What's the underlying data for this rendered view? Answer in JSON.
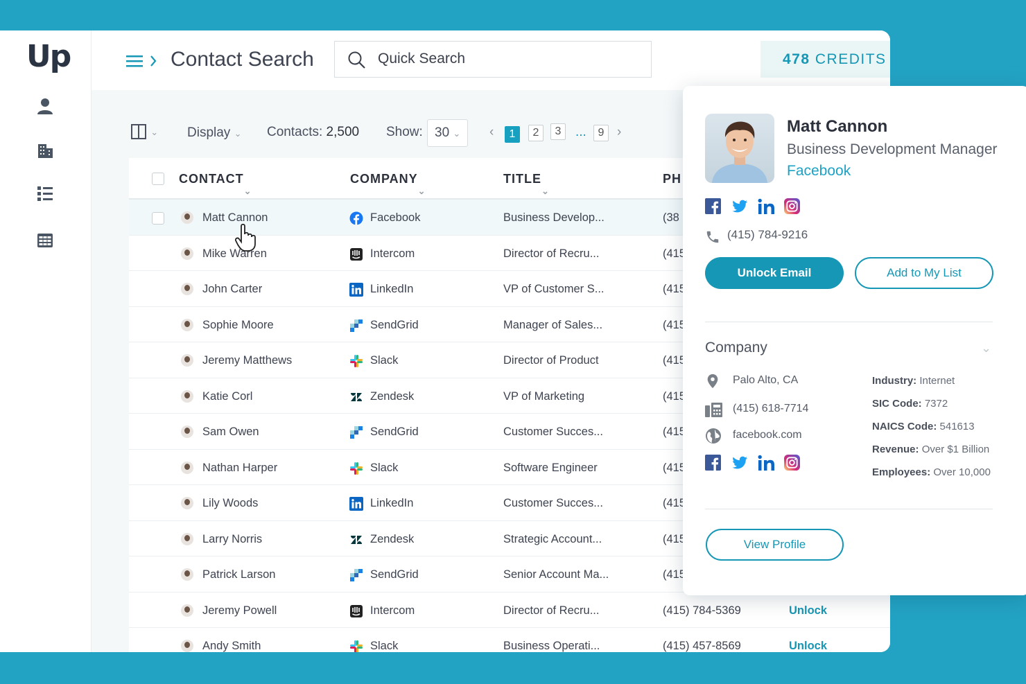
{
  "app": {
    "logo": "Up",
    "page_title": "Contact Search"
  },
  "search": {
    "placeholder": "Quick Search"
  },
  "credits": {
    "count": "478",
    "label": "CREDITS"
  },
  "sidebar": {
    "items": [
      {
        "icon": "user-icon"
      },
      {
        "icon": "building-icon"
      },
      {
        "icon": "list-icon"
      },
      {
        "icon": "grid-icon"
      }
    ]
  },
  "toolbar": {
    "display_label": "Display",
    "contacts_label": "Contacts:",
    "contacts_count": "2,500",
    "show_label": "Show:",
    "show_value": "30",
    "pages": [
      "1",
      "2",
      "3",
      "...",
      "9"
    ],
    "active_page": "1"
  },
  "table": {
    "columns": [
      "CONTACT",
      "COMPANY",
      "TITLE",
      "PH"
    ],
    "rows": [
      {
        "contact": "Matt Cannon",
        "company": "Facebook",
        "title": "Business Develop...",
        "phone": "(38",
        "action": ""
      },
      {
        "contact": "Mike Warren",
        "company": "Intercom",
        "title": "Director of Recru...",
        "phone": "(415",
        "action": ""
      },
      {
        "contact": "John Carter",
        "company": "LinkedIn",
        "title": "VP of Customer S...",
        "phone": "(415",
        "action": ""
      },
      {
        "contact": "Sophie Moore",
        "company": "SendGrid",
        "title": "Manager of Sales...",
        "phone": "(415",
        "action": ""
      },
      {
        "contact": "Jeremy Matthews",
        "company": "Slack",
        "title": "Director of Product",
        "phone": "(415",
        "action": ""
      },
      {
        "contact": "Katie Corl",
        "company": "Zendesk",
        "title": "VP of Marketing",
        "phone": "(415",
        "action": ""
      },
      {
        "contact": "Sam Owen",
        "company": "SendGrid",
        "title": "Customer Succes...",
        "phone": "(415",
        "action": ""
      },
      {
        "contact": "Nathan Harper",
        "company": "Slack",
        "title": "Software Engineer",
        "phone": "(415",
        "action": ""
      },
      {
        "contact": "Lily Woods",
        "company": "LinkedIn",
        "title": "Customer Succes...",
        "phone": "(415",
        "action": ""
      },
      {
        "contact": "Larry Norris",
        "company": "Zendesk",
        "title": "Strategic Account...",
        "phone": "(415",
        "action": ""
      },
      {
        "contact": "Patrick Larson",
        "company": "SendGrid",
        "title": "Senior Account Ma...",
        "phone": "(415",
        "action": ""
      },
      {
        "contact": "Jeremy Powell",
        "company": "Intercom",
        "title": "Director of Recru...",
        "phone": "(415) 784-5369",
        "action": "Unlock"
      },
      {
        "contact": "Andy Smith",
        "company": "Slack",
        "title": "Business Operati...",
        "phone": "(415) 457-8569",
        "action": "Unlock"
      }
    ]
  },
  "profile": {
    "name": "Matt Cannon",
    "title": "Business Development Manager",
    "company": "Facebook",
    "phone": "(415) 784-9216",
    "unlock_label": "Unlock Email",
    "add_label": "Add to My List",
    "company_section": "Company",
    "location": "Palo Alto, CA",
    "company_phone": "(415) 618-7714",
    "website": "facebook.com",
    "industry_label": "Industry:",
    "industry": "Internet",
    "sic_label": "SIC Code:",
    "sic": "7372",
    "naics_label": "NAICS Code:",
    "naics": "541613",
    "revenue_label": "Revenue:",
    "revenue": "Over $1 Billion",
    "employees_label": "Employees:",
    "employees": "Over 10,000",
    "view_profile_label": "View Profile"
  },
  "colors": {
    "accent": "#1697b5",
    "background": "#23a3c4"
  }
}
